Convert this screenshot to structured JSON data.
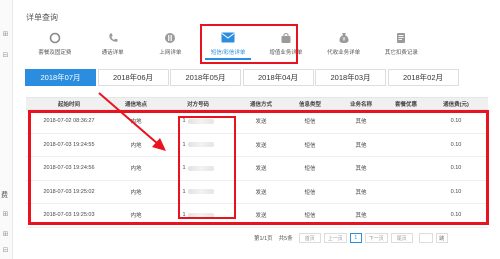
{
  "section_title": "详单查询",
  "categories": [
    {
      "label": "套餐及固定费",
      "icon": "circle-icon",
      "active": false
    },
    {
      "label": "通话详单",
      "icon": "phone-icon",
      "active": false
    },
    {
      "label": "上网详单",
      "icon": "data-icon",
      "active": false
    },
    {
      "label": "短信/彩信详单",
      "icon": "envelope-icon",
      "active": true
    },
    {
      "label": "增值业务详单",
      "icon": "bag-icon",
      "active": false
    },
    {
      "label": "代收业务详单",
      "icon": "moneybag-icon",
      "active": false
    },
    {
      "label": "其它扣费记录",
      "icon": "document-icon",
      "active": false
    }
  ],
  "months": [
    {
      "label": "2018年07月",
      "active": true
    },
    {
      "label": "2018年06月",
      "active": false
    },
    {
      "label": "2018年05月",
      "active": false
    },
    {
      "label": "2018年04月",
      "active": false
    },
    {
      "label": "2018年03月",
      "active": false
    },
    {
      "label": "2018年02月",
      "active": false
    }
  ],
  "table": {
    "headers": [
      "起始时间",
      "通信地点",
      "对方号码",
      "通信方式",
      "信息类型",
      "业务名称",
      "套餐优惠",
      "通信费(元)"
    ],
    "rows": [
      [
        "2018-07-02 08:36:27",
        "内地",
        "1",
        "发送",
        "短信",
        "其他",
        "",
        "0.10"
      ],
      [
        "2018-07-03 19:24:55",
        "内地",
        "1",
        "发送",
        "短信",
        "其他",
        "",
        "0.10"
      ],
      [
        "2018-07-03 19:24:56",
        "内地",
        "1",
        "发送",
        "短信",
        "其他",
        "",
        "0.10"
      ],
      [
        "2018-07-03 19:25:02",
        "内地",
        "1",
        "发送",
        "短信",
        "其他",
        "",
        "0.10"
      ],
      [
        "2018-07-03 19:25:03",
        "内地",
        "1",
        "发送",
        "短信",
        "其他",
        "",
        "0.10"
      ]
    ]
  },
  "pagination": {
    "page_info": "第1/1页",
    "total": "共5条",
    "first": "首页",
    "prev": "上一页",
    "current": "1",
    "next": "下一页",
    "last": "尾页",
    "go": "跳"
  },
  "left_strip": {
    "label": "费"
  },
  "colors": {
    "accent": "#2a8de0",
    "annotation": "#e8131e"
  }
}
